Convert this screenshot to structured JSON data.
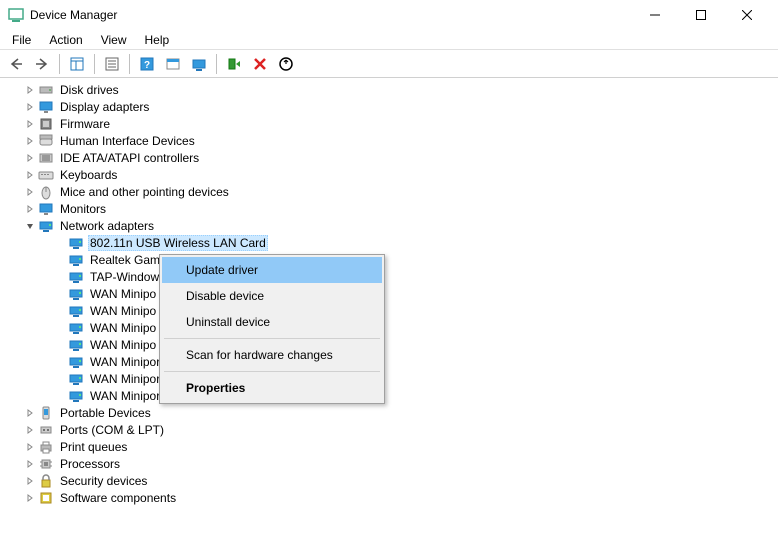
{
  "window": {
    "title": "Device Manager"
  },
  "menubar": {
    "items": [
      "File",
      "Action",
      "View",
      "Help"
    ]
  },
  "tree": {
    "categories": [
      {
        "label": "Disk drives",
        "icon": "disk",
        "expanded": false
      },
      {
        "label": "Display adapters",
        "icon": "display",
        "expanded": false
      },
      {
        "label": "Firmware",
        "icon": "firmware",
        "expanded": false
      },
      {
        "label": "Human Interface Devices",
        "icon": "hid",
        "expanded": false
      },
      {
        "label": "IDE ATA/ATAPI controllers",
        "icon": "ide",
        "expanded": false
      },
      {
        "label": "Keyboards",
        "icon": "keyboard",
        "expanded": false
      },
      {
        "label": "Mice and other pointing devices",
        "icon": "mouse",
        "expanded": false
      },
      {
        "label": "Monitors",
        "icon": "monitor",
        "expanded": false
      },
      {
        "label": "Network adapters",
        "icon": "network",
        "expanded": true,
        "children": [
          {
            "label": "802.11n USB Wireless LAN Card",
            "selected": true
          },
          {
            "label": "Realtek Gami"
          },
          {
            "label": "TAP-Window"
          },
          {
            "label": "WAN Minipo"
          },
          {
            "label": "WAN Minipo"
          },
          {
            "label": "WAN Minipo"
          },
          {
            "label": "WAN Minipo"
          },
          {
            "label": "WAN Miniport (PPPOE)"
          },
          {
            "label": "WAN Miniport (PPTP)"
          },
          {
            "label": "WAN Miniport (SSTP)"
          }
        ]
      },
      {
        "label": "Portable Devices",
        "icon": "portable",
        "expanded": false
      },
      {
        "label": "Ports (COM & LPT)",
        "icon": "ports",
        "expanded": false
      },
      {
        "label": "Print queues",
        "icon": "printer",
        "expanded": false
      },
      {
        "label": "Processors",
        "icon": "cpu",
        "expanded": false
      },
      {
        "label": "Security devices",
        "icon": "security",
        "expanded": false
      },
      {
        "label": "Software components",
        "icon": "software",
        "expanded": false
      }
    ]
  },
  "context_menu": {
    "items": [
      {
        "label": "Update driver",
        "hover": true
      },
      {
        "label": "Disable device"
      },
      {
        "label": "Uninstall device"
      },
      {
        "sep": true
      },
      {
        "label": "Scan for hardware changes"
      },
      {
        "sep": true
      },
      {
        "label": "Properties",
        "bold": true
      }
    ]
  }
}
